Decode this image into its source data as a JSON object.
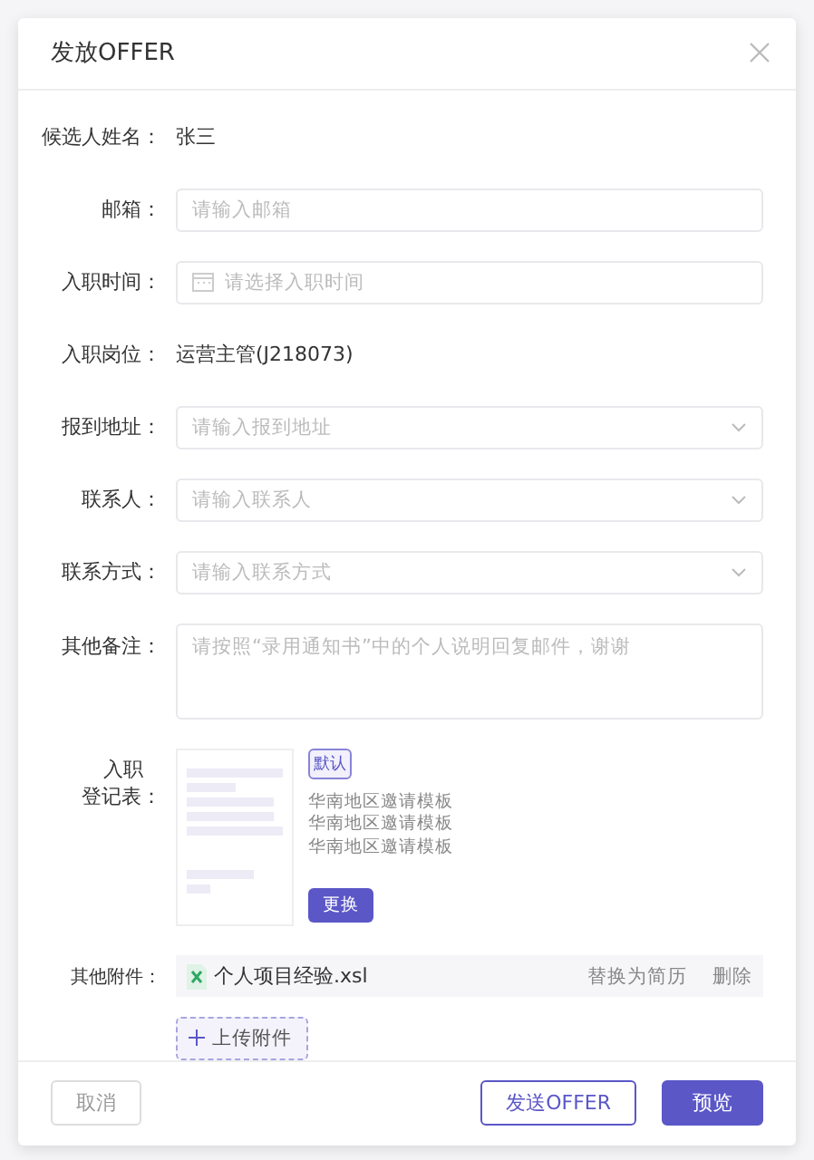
{
  "dialog": {
    "title": "发放OFFER"
  },
  "fields": [
    {
      "kind": "text",
      "label": "候选人姓名：",
      "value": "张三"
    },
    {
      "kind": "input",
      "label": "邮箱：",
      "placeholder": "请输入邮箱"
    },
    {
      "kind": "date",
      "label": "入职时间：",
      "placeholder": "请选择入职时间"
    },
    {
      "kind": "text",
      "label": "入职岗位：",
      "value": "运营主管(J218073)"
    },
    {
      "kind": "select",
      "label": "报到地址：",
      "placeholder": "请输入报到地址"
    },
    {
      "kind": "select",
      "label": "联系人：",
      "placeholder": "请输入联系人"
    },
    {
      "kind": "select",
      "label": "联系方式：",
      "placeholder": "请输入联系方式"
    },
    {
      "kind": "textarea",
      "label": "其他备注：",
      "placeholder": "请按照“录用通知书”中的个人说明回复邮件，谢谢"
    }
  ],
  "registration": {
    "label_lines": [
      "入职",
      "登记表："
    ],
    "badge": "默认",
    "template_name": "华南地区邀请模板华南地区邀请模板华南地区邀请模板",
    "change_button": "更换"
  },
  "attachments": {
    "label": "其他附件：",
    "files": [
      {
        "name": "个人项目经验.xsl",
        "actions": [
          "替换为简历",
          "删除"
        ]
      }
    ],
    "upload_button": "上传附件"
  },
  "footer": {
    "cancel": "取消",
    "send": "发送OFFER",
    "preview": "预览"
  }
}
